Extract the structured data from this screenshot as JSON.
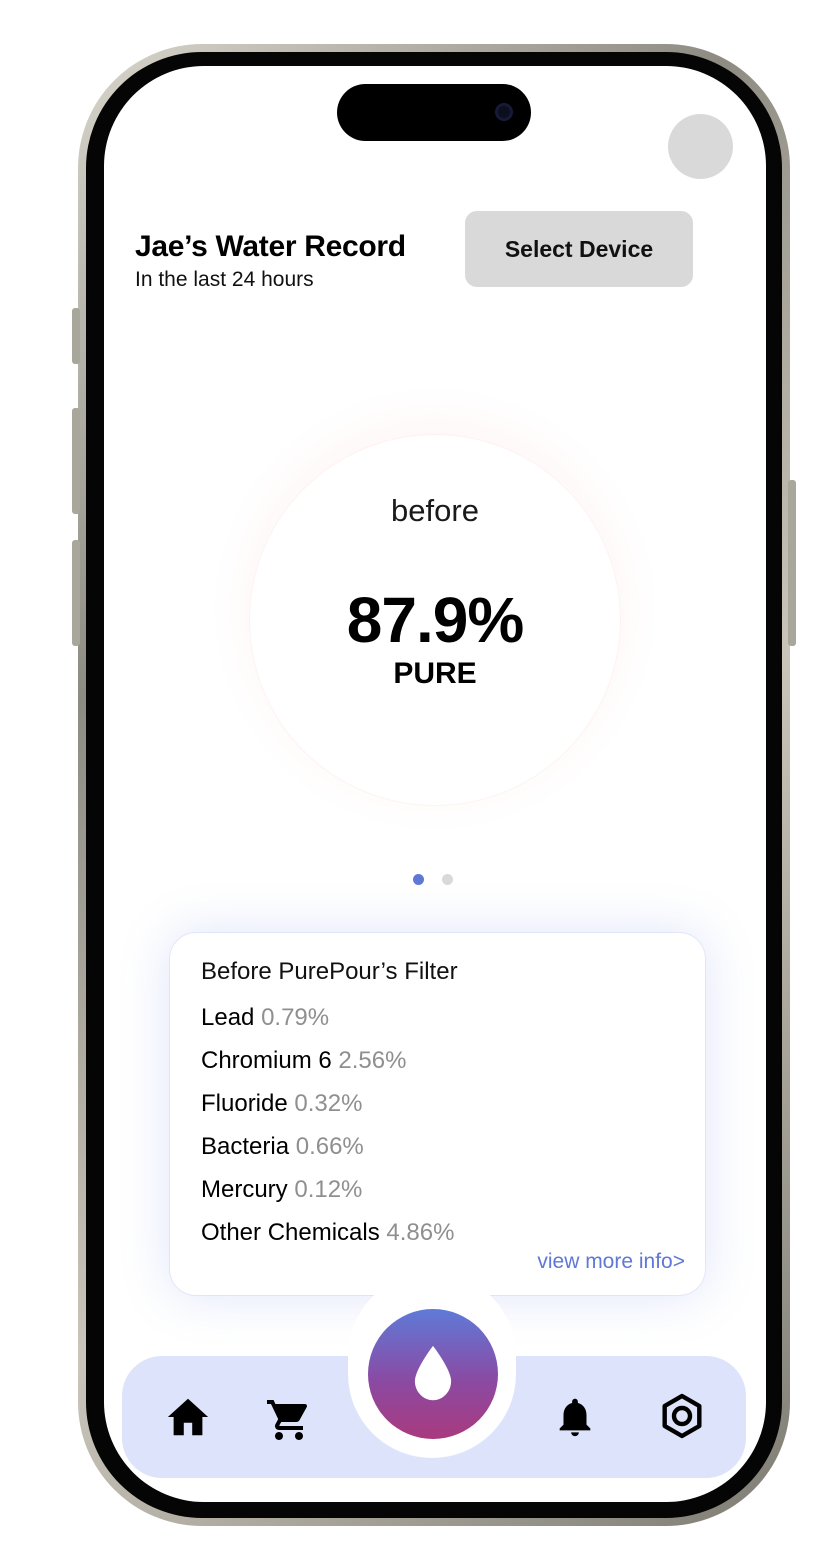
{
  "header": {
    "title": "Jae’s Water Record",
    "subtitle": "In the last 24 hours",
    "select_device_label": "Select Device"
  },
  "purity": {
    "label": "before",
    "value": "87.9%",
    "unit": "PURE",
    "ring_color": "#ffdede"
  },
  "pager": {
    "count": 2,
    "active": 0,
    "active_color": "#5f78d6"
  },
  "filter_card": {
    "title": "Before PurePour’s Filter",
    "items": [
      {
        "name": "Lead",
        "value": "0.79%"
      },
      {
        "name": "Chromium 6",
        "value": "2.56%"
      },
      {
        "name": "Fluoride",
        "value": "0.32%"
      },
      {
        "name": "Bacteria",
        "value": "0.66%"
      },
      {
        "name": "Mercury",
        "value": "0.12%"
      },
      {
        "name": "Other Chemicals",
        "value": "4.86%"
      }
    ],
    "link_label": "view more info>",
    "link_color": "#5f78d6"
  },
  "nav": {
    "background": "#dde3fb",
    "items": [
      "home-icon",
      "cart-icon",
      "water-drop-icon",
      "bell-icon",
      "settings-icon"
    ],
    "center_gradient": [
      "#5f7ad8",
      "#a93a7e"
    ]
  }
}
